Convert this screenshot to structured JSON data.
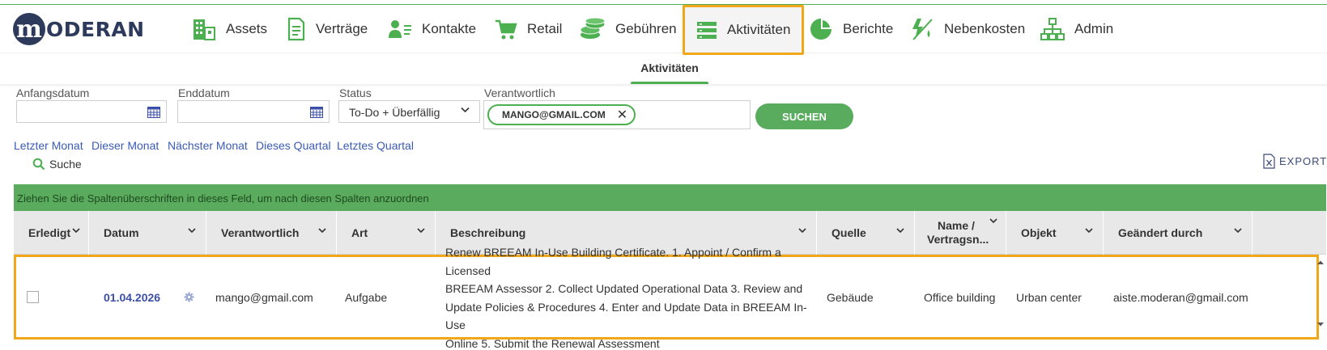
{
  "brand": {
    "logo_letter": "m",
    "logo_text": "ODERAN",
    "color": "#2d3a5c"
  },
  "colors": {
    "accent_green": "#4caf50",
    "highlight_orange": "#f0a81a",
    "link_blue": "#3b5bb5"
  },
  "nav": {
    "items": [
      {
        "label": "Assets",
        "icon": "building-icon"
      },
      {
        "label": "Verträge",
        "icon": "document-icon"
      },
      {
        "label": "Kontakte",
        "icon": "contacts-icon"
      },
      {
        "label": "Retail",
        "icon": "cart-icon"
      },
      {
        "label": "Gebühren",
        "icon": "coins-icon"
      },
      {
        "label": "Aktivitäten",
        "icon": "tasks-icon",
        "active": true
      },
      {
        "label": "Berichte",
        "icon": "pie-chart-icon"
      },
      {
        "label": "Nebenkosten",
        "icon": "utilities-icon"
      },
      {
        "label": "Admin",
        "icon": "hierarchy-icon"
      }
    ]
  },
  "subnav": {
    "tab": "Aktivitäten"
  },
  "filters": {
    "start_label": "Anfangsdatum",
    "end_label": "Enddatum",
    "status_label": "Status",
    "status_value": "To-Do + Überfällig",
    "responsible_label": "Verantwortlich",
    "responsible_chip": "MANGO@GMAIL.COM",
    "search_button": "SUCHEN"
  },
  "quick_ranges": [
    "Letzter Monat",
    "Dieser Monat",
    "Nächster Monat",
    "Dieses Quartal",
    "Letztes Quartal"
  ],
  "search_label": "Suche",
  "export_label": "EXPORT",
  "grid": {
    "group_hint": "Ziehen Sie die Spaltenüberschriften in dieses Feld, um nach diesen Spalten anzuordnen",
    "columns": [
      "Erledigt",
      "Datum",
      "Verantwortlich",
      "Art",
      "Beschreibung",
      "Quelle",
      "Name / Vertragsn...",
      "Objekt",
      "Geändert durch"
    ],
    "column_name_line1": "Name /",
    "column_name_line2": "Vertragsn...",
    "rows": [
      {
        "done": false,
        "date": "01.04.2026",
        "responsible": "mango@gmail.com",
        "type": "Aufgabe",
        "description": "Renew BREEAM In-Use Building Certificate. 1. Appoint / Confirm a Licensed BREEAM Assessor 2. Collect Updated Operational Data 3. Review and Update Policies & Procedures 4. Enter and Update Data in BREEAM In-Use Online 5. Submit the Renewal Assessment",
        "description_lines": [
          "Renew BREEAM In-Use Building Certificate. 1. Appoint / Confirm a Licensed",
          "BREEAM Assessor 2. Collect Updated Operational Data 3. Review and",
          "Update Policies & Procedures 4. Enter and Update Data in BREEAM In-Use",
          "Online 5. Submit the Renewal Assessment"
        ],
        "source": "Gebäude",
        "name": "Office building",
        "object": "Urban center",
        "changed_by": "aiste.moderan@gmail.com"
      }
    ]
  }
}
